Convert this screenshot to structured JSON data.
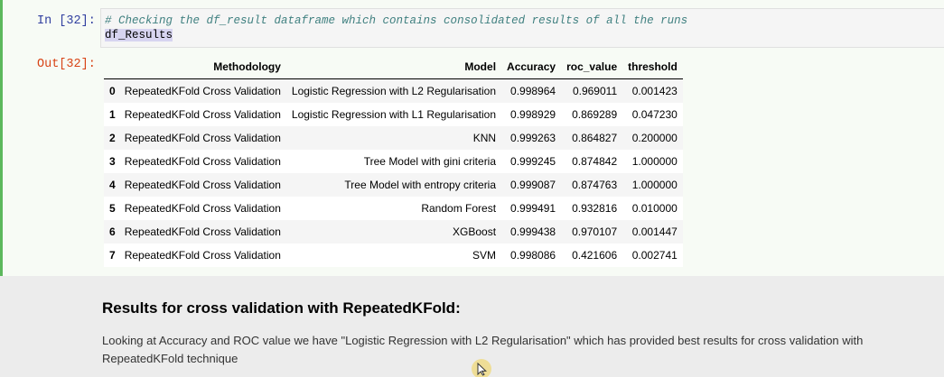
{
  "input_prompt": "In [32]:",
  "output_prompt": "Out[32]:",
  "code": {
    "comment": "# Checking the df_result dataframe which contains consolidated results of all the runs",
    "line2": "df_Results"
  },
  "table": {
    "columns": [
      "",
      "Methodology",
      "Model",
      "Accuracy",
      "roc_value",
      "threshold"
    ],
    "rows": [
      {
        "index": "0",
        "methodology": "RepeatedKFold Cross Validation",
        "model": "Logistic Regression with L2 Regularisation",
        "accuracy": "0.998964",
        "roc_value": "0.969011",
        "threshold": "0.001423"
      },
      {
        "index": "1",
        "methodology": "RepeatedKFold Cross Validation",
        "model": "Logistic Regression with L1 Regularisation",
        "accuracy": "0.998929",
        "roc_value": "0.869289",
        "threshold": "0.047230"
      },
      {
        "index": "2",
        "methodology": "RepeatedKFold Cross Validation",
        "model": "KNN",
        "accuracy": "0.999263",
        "roc_value": "0.864827",
        "threshold": "0.200000"
      },
      {
        "index": "3",
        "methodology": "RepeatedKFold Cross Validation",
        "model": "Tree Model with gini criteria",
        "accuracy": "0.999245",
        "roc_value": "0.874842",
        "threshold": "1.000000"
      },
      {
        "index": "4",
        "methodology": "RepeatedKFold Cross Validation",
        "model": "Tree Model with entropy criteria",
        "accuracy": "0.999087",
        "roc_value": "0.874763",
        "threshold": "1.000000"
      },
      {
        "index": "5",
        "methodology": "RepeatedKFold Cross Validation",
        "model": "Random Forest",
        "accuracy": "0.999491",
        "roc_value": "0.932816",
        "threshold": "0.010000"
      },
      {
        "index": "6",
        "methodology": "RepeatedKFold Cross Validation",
        "model": "XGBoost",
        "accuracy": "0.999438",
        "roc_value": "0.970107",
        "threshold": "0.001447"
      },
      {
        "index": "7",
        "methodology": "RepeatedKFold Cross Validation",
        "model": "SVM",
        "accuracy": "0.998086",
        "roc_value": "0.421606",
        "threshold": "0.002741"
      }
    ]
  },
  "markdown": {
    "heading": "Results for cross validation with RepeatedKFold:",
    "text": "Looking at Accuracy and ROC value we have \"Logistic Regression with L2 Regularisation\" which has provided best results for cross validation with RepeatedKFold technique"
  },
  "colors": {
    "selected_border": "#5cb85c",
    "prompt_in": "#303f9f",
    "prompt_out": "#d84315",
    "comment": "#408080"
  },
  "icons": {
    "cursor": "mouse-pointer-icon"
  }
}
